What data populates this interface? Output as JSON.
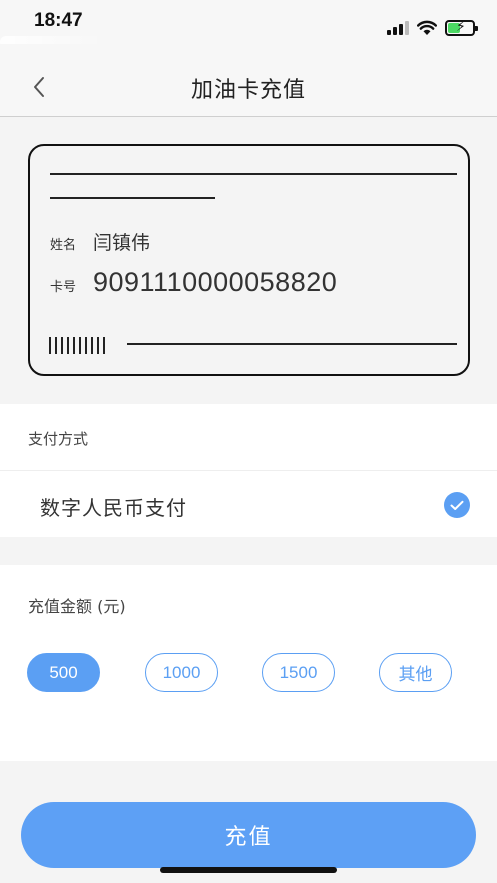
{
  "status_bar": {
    "time": "18:47"
  },
  "nav": {
    "title": "加油卡充值",
    "back_icon": "chevron-left-icon"
  },
  "card": {
    "name_label": "姓名",
    "name_value": "闫镇伟",
    "number_label": "卡号",
    "number_value": "9091110000058820"
  },
  "payment": {
    "heading": "支付方式",
    "option_label": "数字人民币支付",
    "option_selected": true,
    "check_icon": "check-circle-icon"
  },
  "amount": {
    "heading": "充值金额 (元)",
    "options": [
      "500",
      "1000",
      "1500",
      "其他"
    ],
    "selected": "500"
  },
  "submit": {
    "label": "充值"
  },
  "colors": {
    "accent": "#5b9ff3",
    "background": "#f4f4f4"
  }
}
